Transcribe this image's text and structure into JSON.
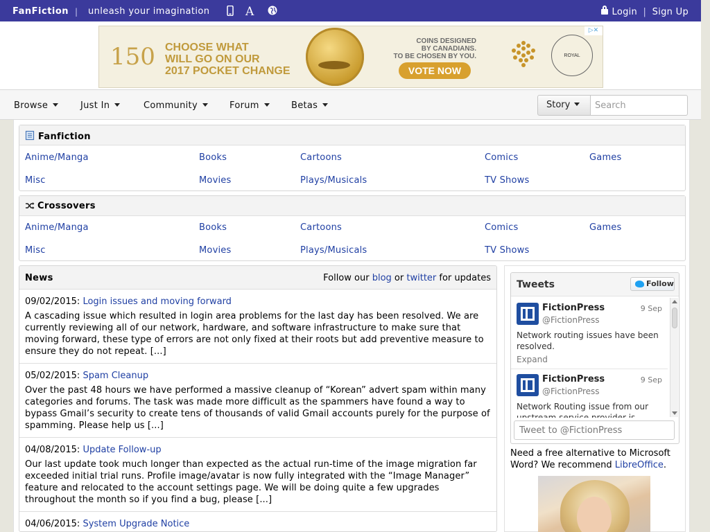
{
  "topbar": {
    "brand": "FanFiction",
    "separator": "|",
    "tagline": "unleash your imagination",
    "icons": [
      "mobile-icon",
      "font-size-icon",
      "globe-icon"
    ],
    "login": "Login",
    "auth_separator": "|",
    "signup": "Sign Up",
    "bg_color": "#3b3a9c"
  },
  "ad": {
    "logo": "150",
    "headline_1": "CHOOSE WHAT",
    "headline_2": "WILL GO ON OUR",
    "headline_3": "2017 POCKET CHANGE",
    "sub_1": "COINS DESIGNED",
    "sub_2": "BY CANADIANS.",
    "sub_3": "TO BE CHOSEN BY YOU.",
    "cta": "VOTE NOW",
    "mint": "ROYAL CANADIAN MINT",
    "choices": "▷✕"
  },
  "nav": {
    "items": [
      "Browse",
      "Just In",
      "Community",
      "Forum",
      "Betas"
    ],
    "search_type": "Story",
    "search_placeholder": "Search"
  },
  "fanfiction": {
    "title": "Fanfiction",
    "categories": [
      "Anime/Manga",
      "Books",
      "Cartoons",
      "Comics",
      "Games",
      "Misc",
      "Movies",
      "Plays/Musicals",
      "TV Shows"
    ]
  },
  "crossovers": {
    "title": "Crossovers",
    "categories": [
      "Anime/Manga",
      "Books",
      "Cartoons",
      "Comics",
      "Games",
      "Misc",
      "Movies",
      "Plays/Musicals",
      "TV Shows"
    ]
  },
  "news": {
    "title": "News",
    "follow_pre": "Follow our",
    "blog": "blog",
    "follow_or": "or",
    "twitter": "twitter",
    "follow_post": "for updates",
    "items": [
      {
        "date": "09/02/2015:",
        "title": "Login issues and moving forward",
        "body": "A cascading issue which resulted in login area problems for the last day has been resolved. We are currently reviewing all of our network, hardware, and software infrastructure to make sure that moving forward, these type of errors are not only fixed at their roots but add preventive measure to ensure they do not repeat. [...]"
      },
      {
        "date": "05/02/2015:",
        "title": "Spam Cleanup",
        "body": "Over the past 48 hours we have performed a massive cleanup of “Korean” advert spam within many categories and forums. The task was made more difficult as the spammers have found a way to bypass Gmail’s security to create tens of thousands of valid Gmail accounts purely for the purpose of spamming. Please help us [...]"
      },
      {
        "date": "04/08/2015:",
        "title": "Update Follow-up",
        "body": "Our last update took much longer than expected as the actual run-time of the image migration far exceeded initial trial runs. Profile image/avatar is now fully integrated with the “Image Manager” feature and relocated to the account settings page. We will be doing quite a few upgrades throughout the month so if you find a bug, please [...]"
      },
      {
        "date": "04/06/2015:",
        "title": "System Upgrade Notice",
        "body": ""
      }
    ]
  },
  "tweets": {
    "title": "Tweets",
    "follow_button": "Follow",
    "items": [
      {
        "name": "FictionPress",
        "handle": "@FictionPress",
        "date": "9 Sep",
        "text": "Network routing issues have been resolved.",
        "expand": "Expand"
      },
      {
        "name": "FictionPress",
        "handle": "@FictionPress",
        "date": "9 Sep",
        "text": "Network Routing issue from our upstream service provider is",
        "expand": ""
      }
    ],
    "tweet_box": "Tweet to @FictionPress"
  },
  "sidebar": {
    "recommend_pre": "Need a free alternative to Microsoft Word? We recommend",
    "recommend_link": "LibreOffice",
    "recommend_post": "."
  }
}
